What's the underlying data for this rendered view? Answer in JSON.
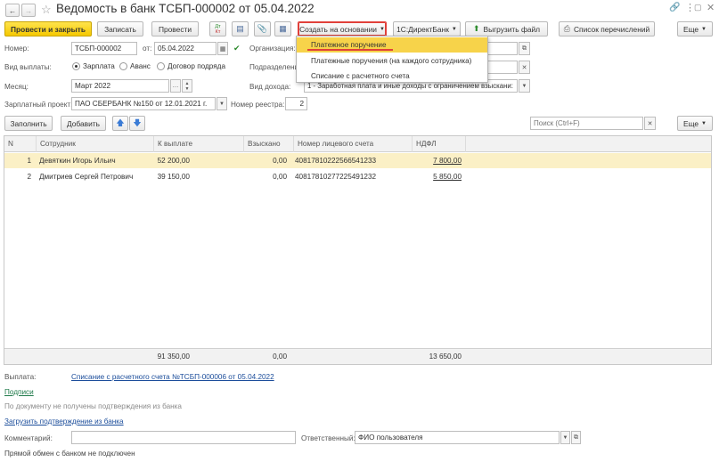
{
  "window": {
    "title": "Ведомость в банк ТСБП-000002 от 05.04.2022"
  },
  "toolbar": {
    "post_close": "Провести и закрыть",
    "save": "Записать",
    "post": "Провести",
    "dt_kt": "Дт Кт",
    "create_based": "Создать на основании",
    "direct_bank": "1С:ДиректБанк",
    "upload_file": "Выгрузить файл",
    "transfer_list": "Список перечислений",
    "more": "Еще"
  },
  "create_menu": {
    "items": [
      "Платежное поручение",
      "Платежные поручения (на каждого сотрудника)",
      "Списание с расчетного счета"
    ]
  },
  "form": {
    "number_label": "Номер:",
    "number": "ТСБП-000002",
    "from_label": "от:",
    "date": "05.04.2022",
    "org_label": "Организация:",
    "payment_type_label": "Вид выплаты:",
    "payment_types": [
      "Зарплата",
      "Аванс",
      "Договор подряда"
    ],
    "division_label": "Подразделение:",
    "month_label": "Месяц:",
    "month": "Март 2022",
    "income_type_label": "Вид дохода:",
    "income_type": "1 - Заработная плата и иные доходы с ограничением взыскани:",
    "salary_project_label": "Зарплатный проект:",
    "salary_project": "ПАО СБЕРБАНК №150 от 12.01.2021 г.",
    "registry_number_label": "Номер реестра:",
    "registry_number": "2"
  },
  "table_toolbar": {
    "fill": "Заполнить",
    "add": "Добавить",
    "search_placeholder": "Поиск (Ctrl+F)",
    "more": "Еще"
  },
  "table": {
    "columns": [
      "N",
      "Сотрудник",
      "К выплате",
      "Взыскано",
      "Номер лицевого счета",
      "НДФЛ"
    ],
    "rows": [
      {
        "n": "1",
        "employee": "Девяткин Игорь Ильич",
        "pay": "52 200,00",
        "withheld": "0,00",
        "account": "40817810222566541233",
        "ndfl": "7 800,00"
      },
      {
        "n": "2",
        "employee": "Дмитриев Сергей Петрович",
        "pay": "39 150,00",
        "withheld": "0,00",
        "account": "40817810277225491232",
        "ndfl": "5 850,00"
      }
    ],
    "totals": {
      "pay": "91 350,00",
      "withheld": "0,00",
      "ndfl": "13 650,00"
    }
  },
  "footer": {
    "payment_label": "Выплата:",
    "payment_link": "Списание с расчетного счета №ТСБП-000006 от 05.04.2022",
    "signatures_link": "Подписи",
    "no_confirmation": "По документу не получены подтверждения из банка",
    "load_confirmation_link": "Загрузить подтверждение из банка",
    "comment_label": "Комментарий:",
    "responsible_label": "Ответственный:",
    "responsible": "ФИО пользователя",
    "bank_status": "Прямой обмен с банком не подключен"
  },
  "colors": {
    "primary_button": "#f5c800",
    "menu_highlight": "#f7d34a",
    "selected_row": "#fbf0c6",
    "link": "#1a4c9a",
    "accent_red": "#e0403a"
  }
}
